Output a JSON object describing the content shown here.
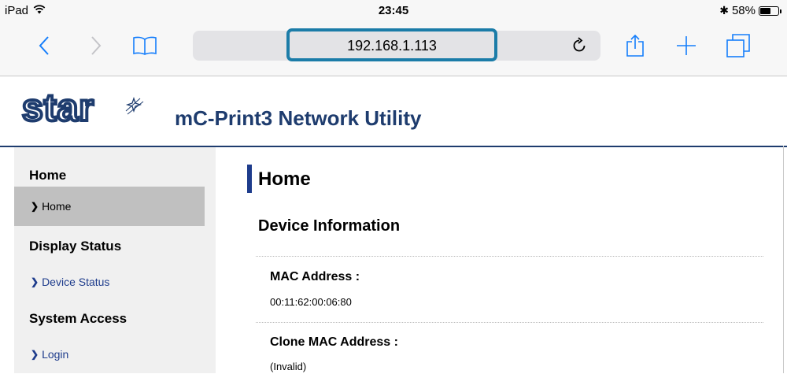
{
  "status_bar": {
    "device": "iPad",
    "time": "23:45",
    "battery_percent": "58%",
    "battery_level": 0.58
  },
  "browser": {
    "url": "192.168.1.113",
    "highlight_color": "#1b7ca8",
    "icons": [
      "back-icon",
      "forward-icon",
      "bookmarks-icon",
      "reload-icon",
      "share-icon",
      "new-tab-icon",
      "tabs-icon"
    ]
  },
  "header": {
    "logo_text": "star",
    "title": "mC-Print3 Network Utility",
    "brand_color": "#1e3c6e"
  },
  "sidebar": {
    "groups": [
      {
        "label": "Home",
        "items": [
          {
            "label": "Home",
            "active": true
          }
        ]
      },
      {
        "label": "Display Status",
        "items": [
          {
            "label": "Device Status",
            "active": false
          }
        ]
      },
      {
        "label": "System Access",
        "items": [
          {
            "label": "Login",
            "active": false
          }
        ]
      }
    ]
  },
  "main": {
    "title": "Home",
    "section": "Device Information",
    "fields": [
      {
        "label": "MAC Address :",
        "value": "00:11:62:00:06:80"
      },
      {
        "label": "Clone MAC Address :",
        "value": "(Invalid)"
      }
    ]
  }
}
